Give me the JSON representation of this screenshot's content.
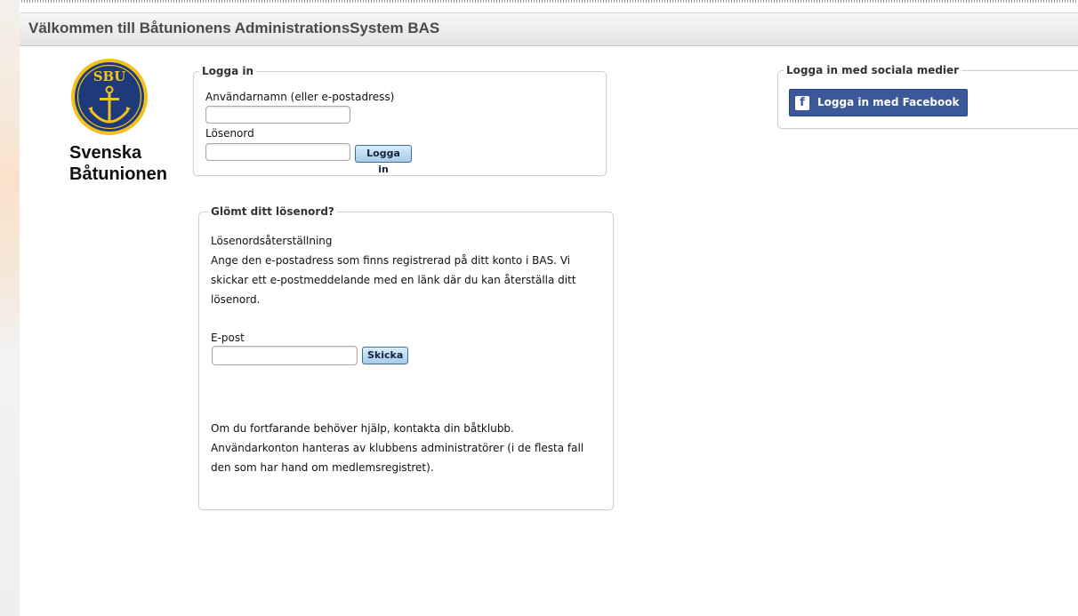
{
  "header": {
    "title": "Välkommen till Båtunionens AdministrationsSystem BAS"
  },
  "logo": {
    "badge_text": "SBU",
    "line1": "Svenska",
    "line2": "Båtunionen"
  },
  "login": {
    "legend": "Logga in",
    "username_label": "Användarnamn (eller e-postadress)",
    "username_value": "",
    "password_label": "Lösenord",
    "password_value": "",
    "submit_label": "Logga in"
  },
  "forgot": {
    "legend": "Glömt ditt lösenord?",
    "heading": "Lösenordsåterställning",
    "description_line1": "Ange den e-postadress som finns registrerad på ditt konto i BAS. Vi",
    "description_line2": "skickar ett e-postmeddelande med en länk där du kan återställa ditt",
    "description_line3": "lösenord.",
    "email_label": "E-post",
    "email_value": "",
    "submit_label": "Skicka",
    "help_line1": "Om du fortfarande behöver hjälp, kontakta din båtklubb.",
    "help_line2": "Användarkonton hanteras av klubbens administratörer (i de flesta fall",
    "help_line3": "den som har hand om medlemsregistret)."
  },
  "social": {
    "legend": "Logga in med sociala medier",
    "facebook_label": "Logga in med Facebook",
    "facebook_icon": "facebook-icon"
  },
  "colors": {
    "facebook_blue": "#3b5998",
    "button_blue": "#a8cbe8",
    "logo_blue": "#1e3a7a",
    "logo_gold": "#f2c21a"
  }
}
